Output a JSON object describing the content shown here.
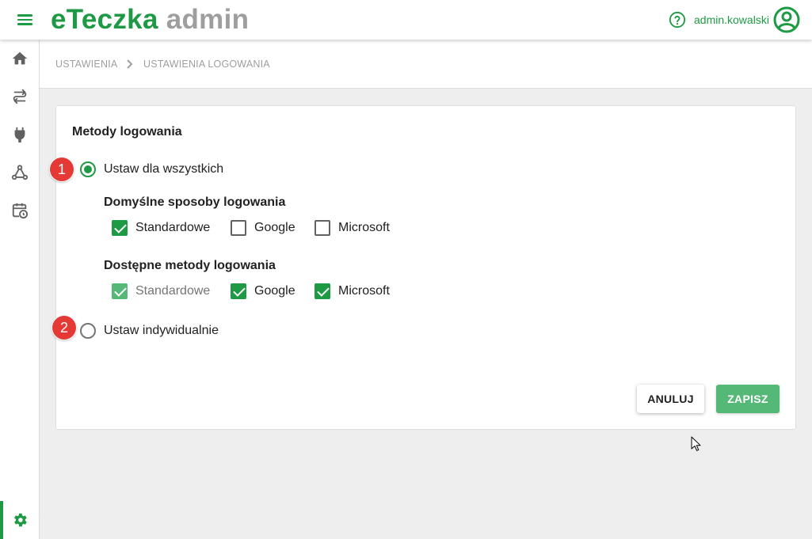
{
  "header": {
    "brand_primary": "eTeczka",
    "brand_secondary": "admin",
    "username": "admin.kowalski",
    "icons": [
      "menu-icon",
      "help-icon",
      "user-avatar-icon"
    ]
  },
  "sidebar": {
    "items": [
      {
        "icon": "home-icon"
      },
      {
        "icon": "workflow-icon"
      },
      {
        "icon": "plug-icon"
      },
      {
        "icon": "network-icon"
      },
      {
        "icon": "calendar-clock-icon"
      }
    ],
    "bottom_item": {
      "icon": "settings-icon",
      "active": true
    }
  },
  "breadcrumb": {
    "items": [
      "USTAWIENIA",
      "USTAWIENIA LOGOWANIA"
    ]
  },
  "form": {
    "title": "Metody logowania",
    "option_all": {
      "label": "Ustaw dla wszystkich",
      "selected": true,
      "badge": "1"
    },
    "default_methods": {
      "title": "Domyślne sposoby logowania",
      "items": [
        {
          "label": "Standardowe",
          "checked": true,
          "disabled": false
        },
        {
          "label": "Google",
          "checked": false,
          "disabled": false
        },
        {
          "label": "Microsoft",
          "checked": false,
          "disabled": false
        }
      ]
    },
    "available_methods": {
      "title": "Dostępne metody logowania",
      "items": [
        {
          "label": "Standardowe",
          "checked": true,
          "disabled": true
        },
        {
          "label": "Google",
          "checked": true,
          "disabled": false
        },
        {
          "label": "Microsoft",
          "checked": true,
          "disabled": false
        }
      ]
    },
    "option_individual": {
      "label": "Ustaw indywidualnie",
      "selected": false,
      "badge": "2"
    },
    "cancel_label": "ANULUJ",
    "save_label": "ZAPISZ"
  },
  "colors": {
    "brand_green": "#1e9a44",
    "brand_gray": "#9e9e9e",
    "badge_red": "#e53935",
    "save_green": "#55b877",
    "background": "#eeeeee"
  }
}
